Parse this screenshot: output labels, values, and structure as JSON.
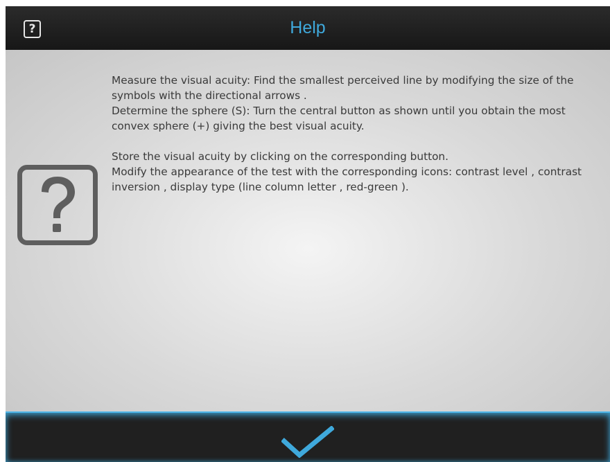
{
  "header": {
    "title": "Help",
    "help_button_glyph": "?"
  },
  "content": {
    "icon": "question-mark-icon",
    "paragraphs": [
      "Measure the visual acuity: Find the smallest perceived line by modifying the size of the symbols with the directional arrows .",
      "Determine the sphere (S): Turn the central button as shown until you obtain the most convex sphere (+) giving the best visual acuity.",
      "Store the visual acuity by clicking on the corresponding button.",
      "Modify the appearance of the test with the corresponding icons: contrast level , contrast inversion , display type (line column letter , red-green )."
    ]
  },
  "footer": {
    "confirm_icon": "checkmark-icon"
  },
  "colors": {
    "accent": "#3fa9dc",
    "header_bg": "#1e1e1e",
    "content_bg": "#d9d9d9",
    "text": "#3a3a3a",
    "icon_gray": "#5e5e5e"
  }
}
